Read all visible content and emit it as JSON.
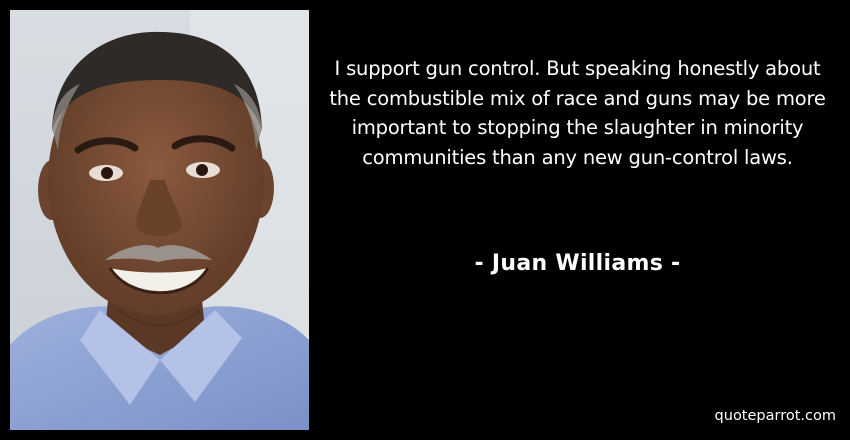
{
  "quote": {
    "text": "I support gun control. But speaking honestly about the combustible mix of race and guns may be more important to stopping the slaughter in minority communities than any new gun-control laws.",
    "author": "- Juan Williams -"
  },
  "brand": {
    "site": "quoteparrot.com"
  },
  "colors": {
    "background": "#000000",
    "text": "#ffffff",
    "shirt": "#8ea3d4"
  }
}
